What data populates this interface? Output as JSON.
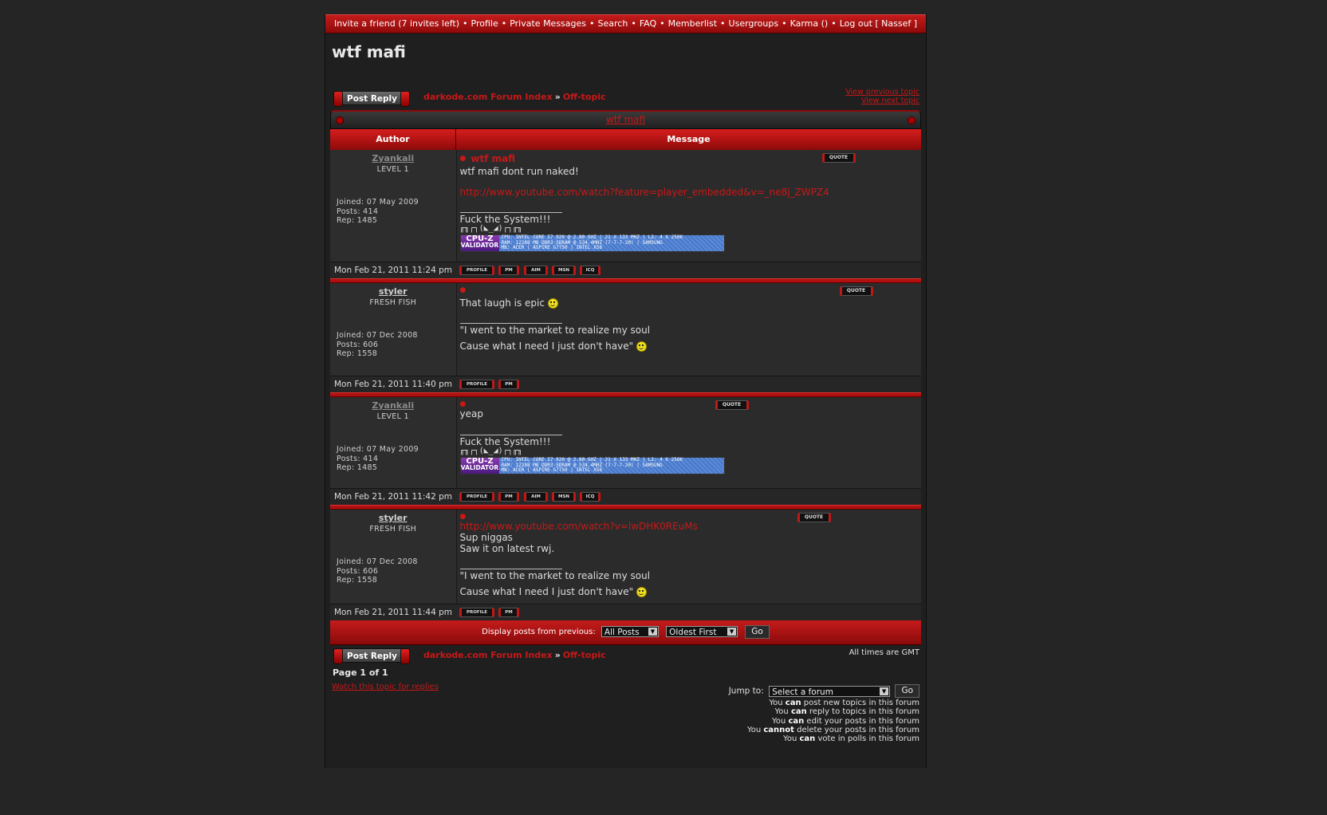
{
  "nav": {
    "items": [
      "Invite a friend (7 invites left)",
      "Profile",
      "Private Messages",
      "Search",
      "FAQ",
      "Memberlist",
      "Usergroups",
      "Karma ()",
      "Log out [ Nassef ]"
    ],
    "separator": "•"
  },
  "topic": {
    "title": "wtf mafi",
    "view_previous": "View previous topic",
    "view_next": "View next topic"
  },
  "buttons": {
    "post_reply": "Post Reply",
    "quote": "QUOTE",
    "profile": "PROFILE",
    "pm": "PM",
    "aim": "AIM",
    "msn": "MSN",
    "icq": "ICQ",
    "go": "Go"
  },
  "breadcrumb": {
    "index": "darkode.com Forum Index",
    "arrow": "»",
    "forum": "Off-topic"
  },
  "table": {
    "author_header": "Author",
    "message_header": "Message"
  },
  "posts": [
    {
      "author": "Zyankali",
      "rank": "LEVEL 1",
      "joined": "Joined: 07 May 2009",
      "posts": "Posts: 414",
      "rep": "Rep: 1485",
      "subject": "wtf mafi",
      "body_line1": "wtf mafi dont run naked!",
      "link": "http://www.youtube.com/watch?feature=player_embedded&v=_ne8j_ZWPZ4",
      "signature": "Fuck the System!!!",
      "ascii": "╓╖┌┐(◣_◢)┌┐╓╖",
      "date": "Mon Feb 21, 2011 11:24 pm"
    },
    {
      "author": "styler",
      "rank": "FRESH FISH",
      "joined": "Joined: 07 Dec 2008",
      "posts": "Posts: 606",
      "rep": "Rep: 1558",
      "body_line1": "That laugh is epic",
      "sig_line1": "\"I went to the market to realize my soul",
      "sig_line2": "Cause what I need I just don't have\"",
      "date": "Mon Feb 21, 2011 11:40 pm"
    },
    {
      "author": "Zyankali",
      "rank": "LEVEL 1",
      "joined": "Joined: 07 May 2009",
      "posts": "Posts: 414",
      "rep": "Rep: 1485",
      "body_line1": "yeap",
      "signature": "Fuck the System!!!",
      "ascii": "╓╖┌┐(◣_◢)┌┐╓╖",
      "date": "Mon Feb 21, 2011 11:42 pm"
    },
    {
      "author": "styler",
      "rank": "FRESH FISH",
      "joined": "Joined: 07 Dec 2008",
      "posts": "Posts: 606",
      "rep": "Rep: 1558",
      "link": "http://www.youtube.com/watch?v=lwDHK0REuMs",
      "body_line1": "Sup niggas",
      "body_line2": "Saw it on latest rwj.",
      "sig_line1": "\"I went to the market to realize my soul",
      "sig_line2": "Cause what I need I just don't have\"",
      "date": "Mon Feb 21, 2011 11:44 pm"
    }
  ],
  "cpuz": {
    "logo_top": "CPU-Z",
    "logo_bottom": "VALIDATOR",
    "line1": "CPU: INTEL CORE I7 920 @ 2.80 GHZ | 21 X 133 MHZ | L2: 4 X 256K",
    "line2": "RAM: 12288 MB DDR3-SDRAM @ 534.4MHZ (7-7-7-20) | SAMSUNG",
    "line3": "MB: ACER | ASPIRE G7750 | INTEL X58"
  },
  "display": {
    "label": "Display posts from previous:",
    "posts_value": "All Posts",
    "order_value": "Oldest First"
  },
  "footer": {
    "timezone": "All times are GMT",
    "page": "Page 1 of 1",
    "watch": "Watch this topic for replies",
    "jump_label": "Jump to:",
    "jump_value": "Select a forum"
  },
  "permissions": [
    {
      "pre": "You ",
      "b": "can",
      "post": " post new topics in this forum"
    },
    {
      "pre": "You ",
      "b": "can",
      "post": " reply to topics in this forum"
    },
    {
      "pre": "You ",
      "b": "can",
      "post": " edit your posts in this forum"
    },
    {
      "pre": "You ",
      "b": "cannot",
      "post": " delete your posts in this forum"
    },
    {
      "pre": "You ",
      "b": "can",
      "post": " vote in polls in this forum"
    }
  ],
  "colors": {
    "accent": "#c81818",
    "bar": "#b11010",
    "background": "#252525"
  }
}
